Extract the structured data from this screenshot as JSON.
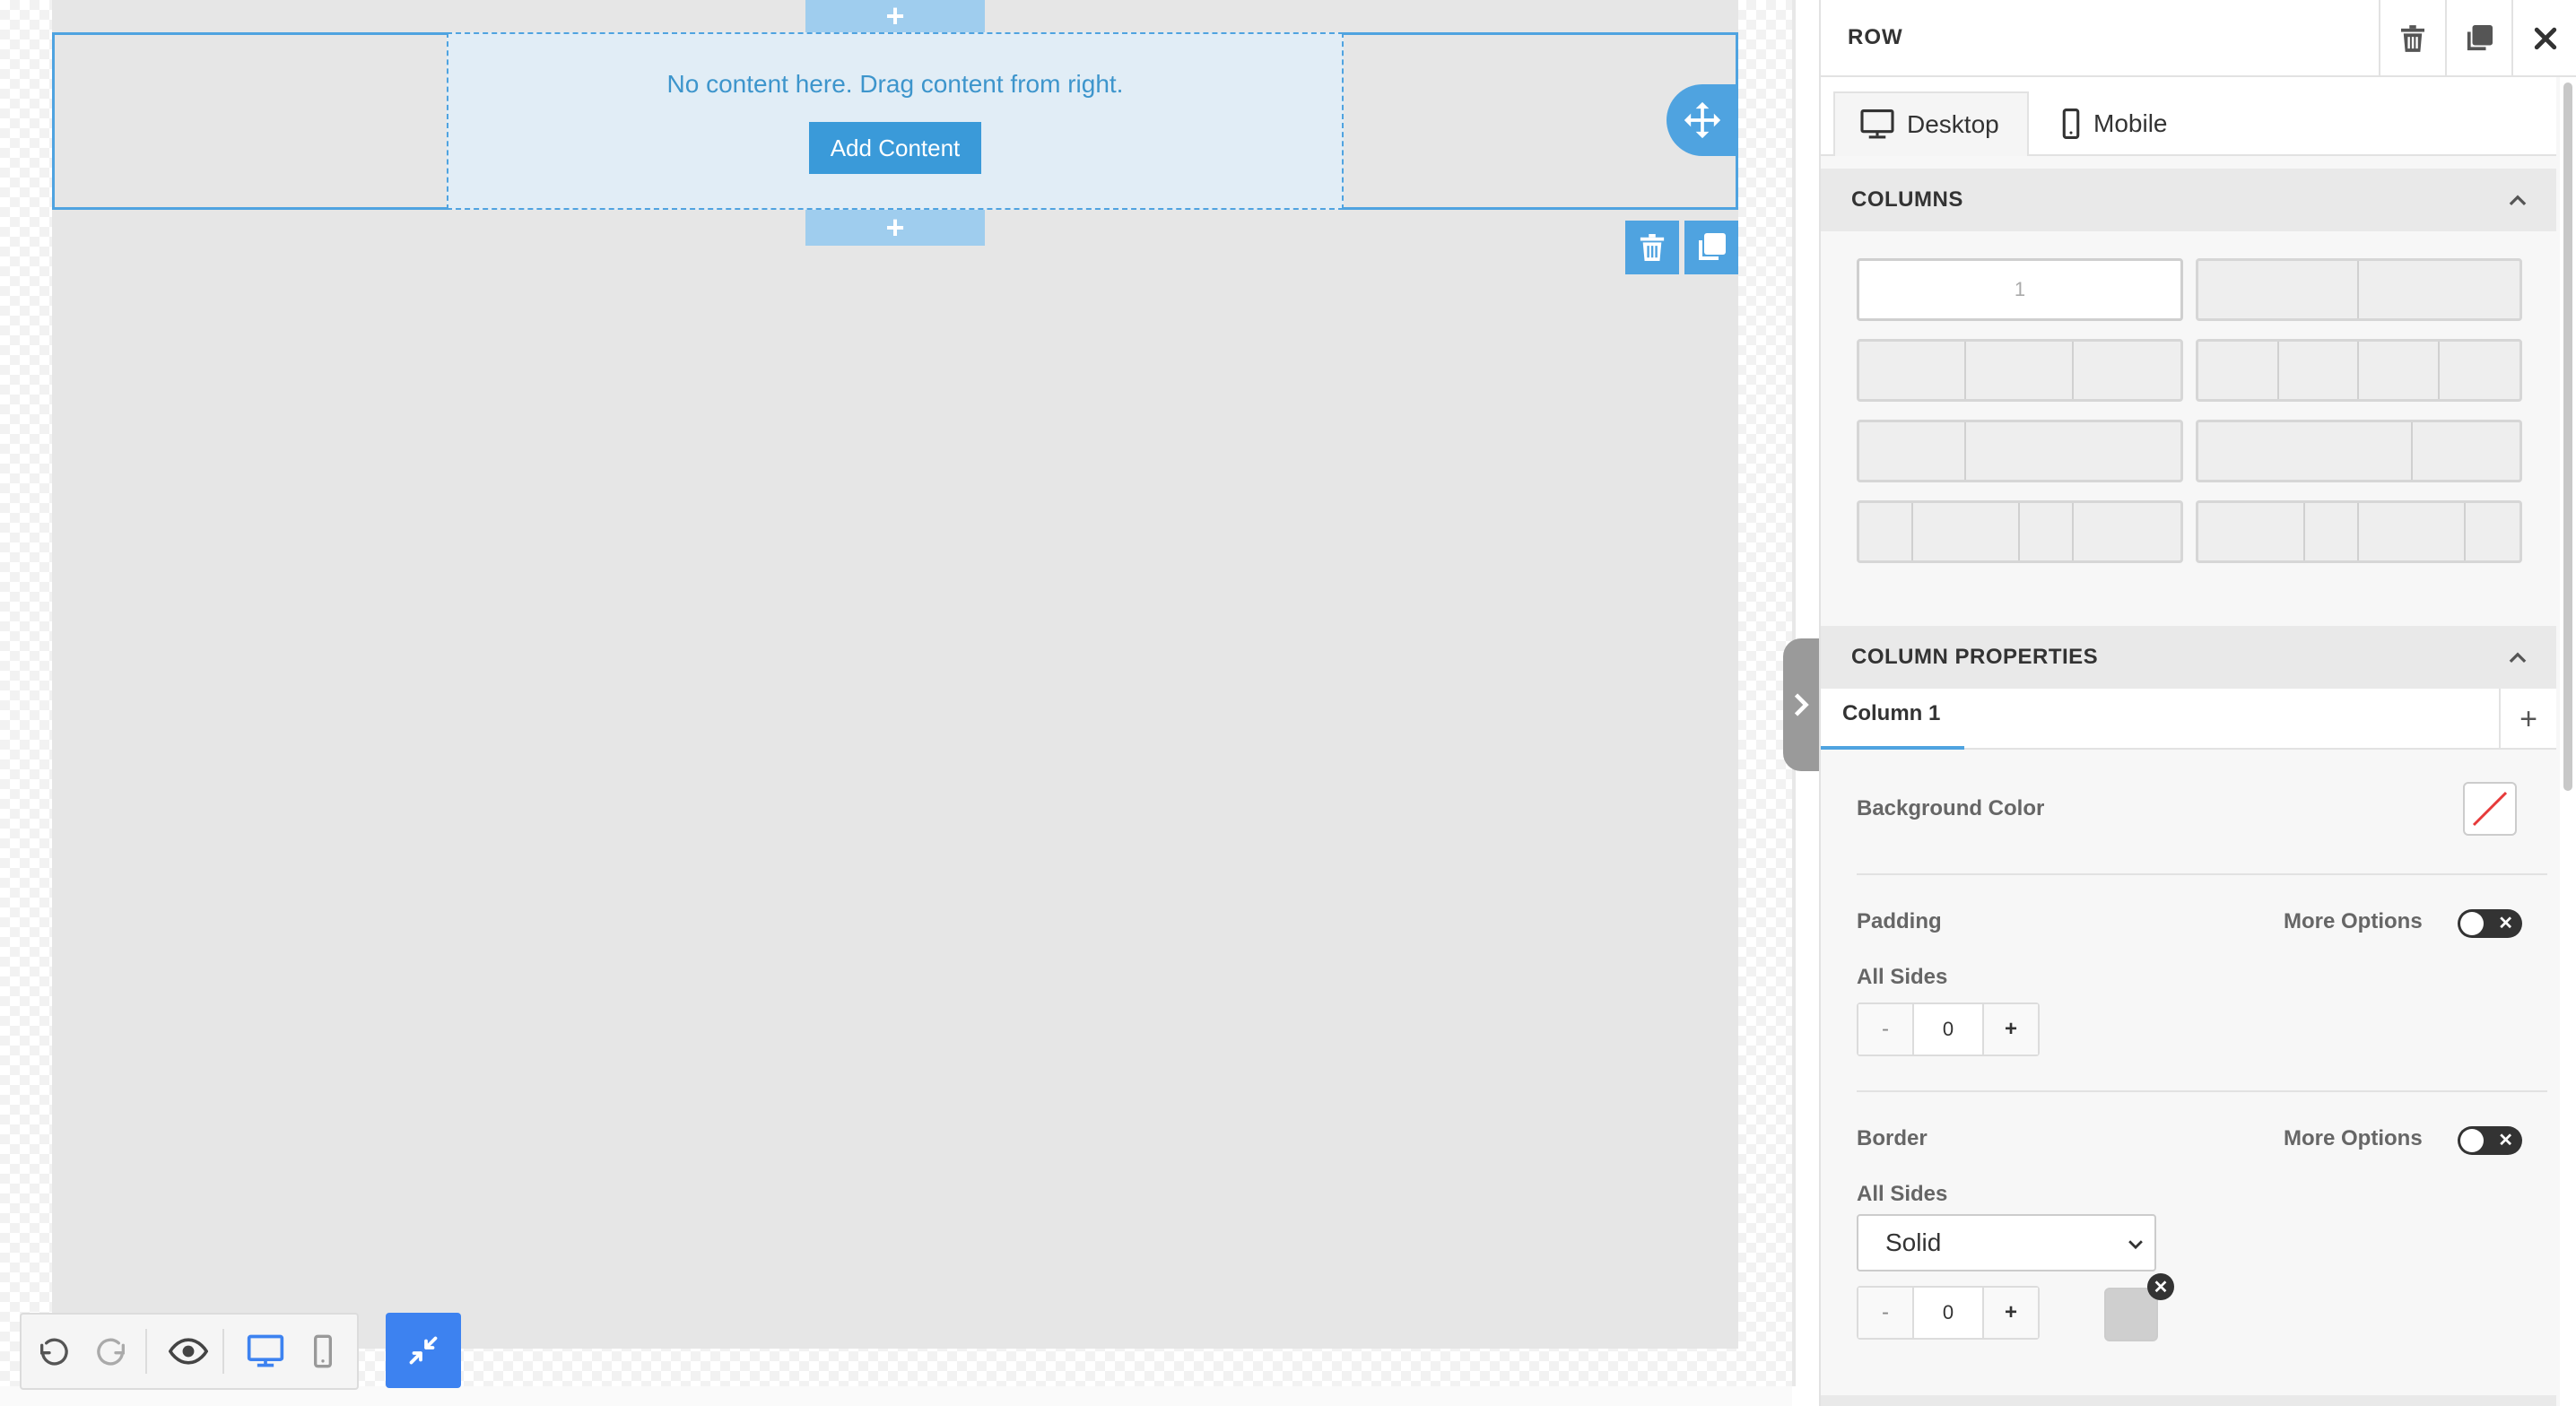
{
  "canvas": {
    "empty_message": "No content here. Drag content from right.",
    "add_content_label": "Add Content",
    "add_row_symbol": "+",
    "icons": [
      "move-icon",
      "trash-icon",
      "copy-icon"
    ]
  },
  "toolbar": {
    "icons": [
      "undo-icon",
      "redo-icon",
      "eye-icon",
      "desktop-icon",
      "mobile-icon",
      "collapse-icon"
    ]
  },
  "panel": {
    "title": "ROW",
    "tabs": [
      {
        "label": "Desktop",
        "active": true
      },
      {
        "label": "Mobile",
        "active": false
      }
    ],
    "columns_section": {
      "title": "COLUMNS",
      "layouts": [
        {
          "label": "1",
          "cells": [
            1
          ],
          "selected": true
        },
        {
          "label": "",
          "cells": [
            1,
            1
          ]
        },
        {
          "label": "",
          "cells": [
            1,
            1,
            1
          ]
        },
        {
          "label": "",
          "cells": [
            1,
            1,
            1,
            1
          ]
        },
        {
          "label": "",
          "cells": [
            1,
            2
          ]
        },
        {
          "label": "",
          "cells": [
            2,
            1
          ]
        },
        {
          "label": "",
          "cells": [
            1,
            2,
            1,
            2
          ]
        },
        {
          "label": "",
          "cells": [
            2,
            1,
            2,
            1
          ]
        }
      ]
    },
    "column_properties": {
      "title": "COLUMN PROPERTIES",
      "active_column": "Column 1",
      "add_symbol": "+",
      "background_color_label": "Background Color",
      "padding": {
        "label": "Padding",
        "more_options": "More Options",
        "sides_label": "All Sides",
        "minus": "-",
        "value": "0",
        "plus": "+"
      },
      "border": {
        "label": "Border",
        "more_options": "More Options",
        "sides_label": "All Sides",
        "style": "Solid",
        "minus": "-",
        "value": "0",
        "plus": "+",
        "color": "#cfcfcf",
        "clear_symbol": "✕"
      }
    }
  },
  "colors": {
    "accent": "#4fa3e0",
    "button": "#3a9ad9",
    "collapse_button": "#3d82f0"
  }
}
